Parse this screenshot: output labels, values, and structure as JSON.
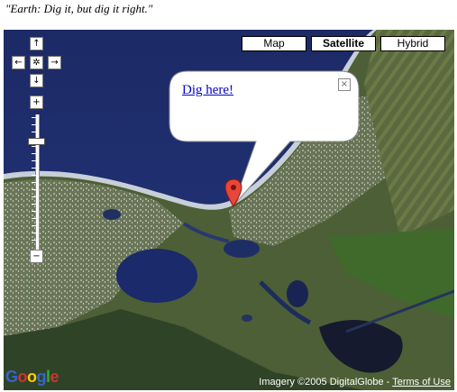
{
  "quote": "\"Earth: Dig it, but dig it right.\"",
  "map": {
    "type_buttons": [
      {
        "label": "Map",
        "active": false
      },
      {
        "label": "Satellite",
        "active": true
      },
      {
        "label": "Hybrid",
        "active": false
      }
    ],
    "pan_controls": {
      "up": "↑",
      "left": "←",
      "center": "✲",
      "right": "→",
      "down": "↓"
    },
    "zoom": {
      "in": "+",
      "out": "−",
      "level_fraction": 0.17
    },
    "info_window": {
      "link_text": "Dig here!",
      "close_glyph": "×"
    },
    "marker": {
      "icon": "red-map-pin-icon",
      "color": "#e8463a"
    },
    "attribution": {
      "imagery": "Imagery ©2005 DigitalGlobe - ",
      "terms_link": "Terms of Use"
    },
    "logo": {
      "text": "Google",
      "colors": [
        "#3366cc",
        "#cc3333",
        "#ffcc00",
        "#3366cc",
        "#33aa33",
        "#cc3333"
      ]
    }
  }
}
